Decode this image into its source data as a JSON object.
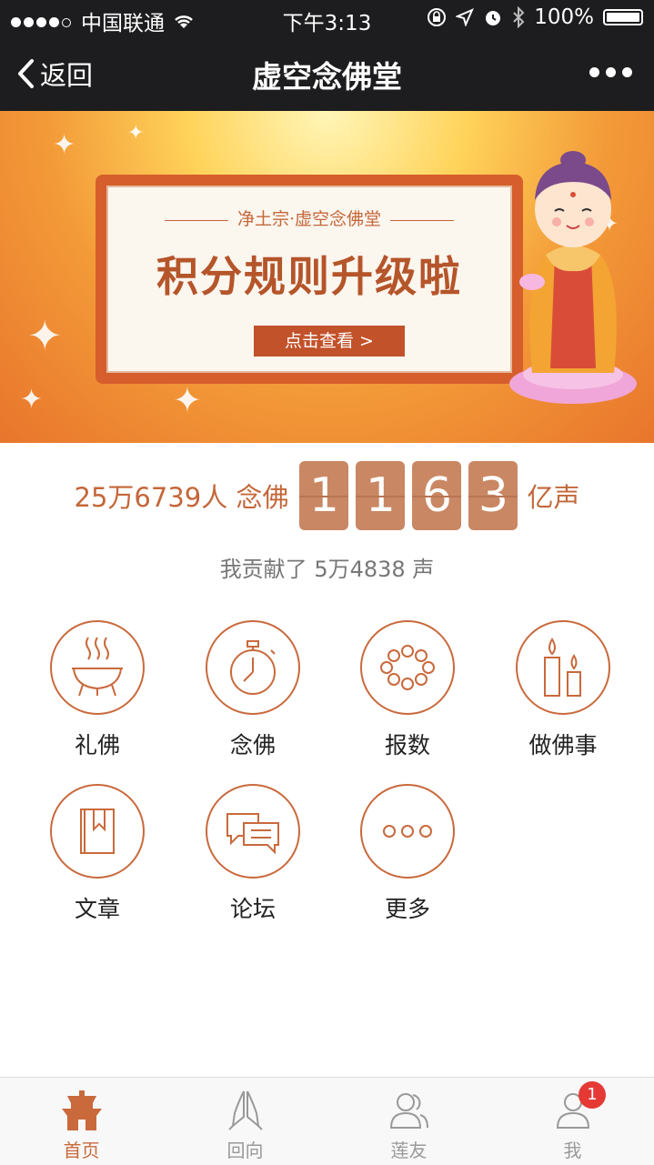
{
  "status_bar": {
    "carrier": "中国联通",
    "time": "下午3:13",
    "battery": "100%"
  },
  "nav": {
    "back_label": "返回",
    "title": "虚空念佛堂"
  },
  "banner": {
    "subtitle": "净土宗·虚空念佛堂",
    "title": "积分规则升级啦",
    "button_label": "点击查看 >"
  },
  "stats": {
    "people": "25万6739人 念佛",
    "digits": [
      "1",
      "1",
      "6",
      "3"
    ],
    "unit": "亿声",
    "contribution": "我贡献了 5万4838 声"
  },
  "menu": [
    {
      "label": "礼佛",
      "icon": "incense-burner-icon"
    },
    {
      "label": "念佛",
      "icon": "stopwatch-icon"
    },
    {
      "label": "报数",
      "icon": "prayer-beads-icon"
    },
    {
      "label": "做佛事",
      "icon": "candles-icon"
    },
    {
      "label": "文章",
      "icon": "book-icon"
    },
    {
      "label": "论坛",
      "icon": "chat-bubbles-icon"
    },
    {
      "label": "更多",
      "icon": "more-dots-icon"
    }
  ],
  "tabs": [
    {
      "label": "首页",
      "icon": "temple-icon",
      "active": true
    },
    {
      "label": "回向",
      "icon": "praying-hands-icon"
    },
    {
      "label": "莲友",
      "icon": "friends-icon"
    },
    {
      "label": "我",
      "icon": "user-icon",
      "badge": "1"
    }
  ],
  "colors": {
    "accent": "#c9693c",
    "nav_bg": "#1d1d1f",
    "digit_bg": "#c98763"
  }
}
